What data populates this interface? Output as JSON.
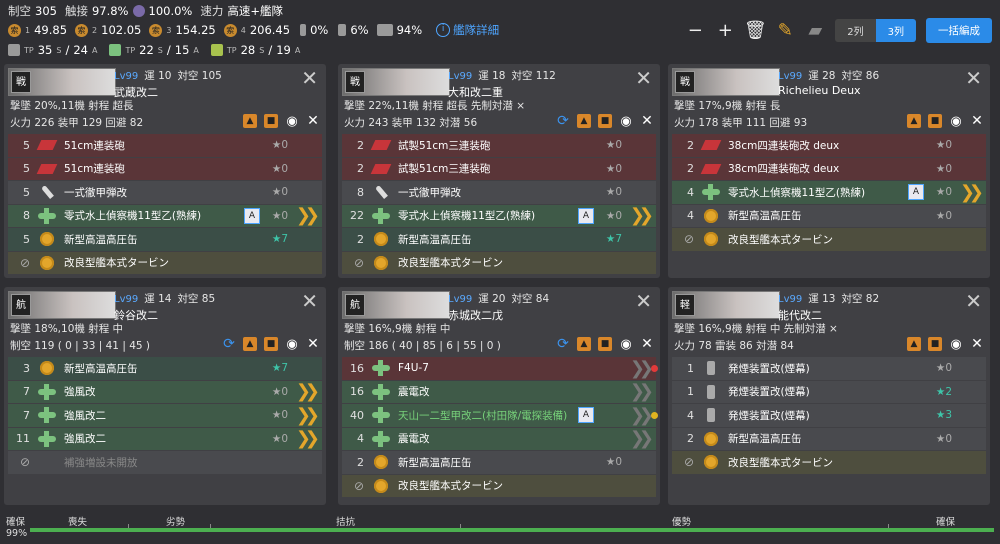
{
  "header": {
    "air_label": "制空",
    "air": "305",
    "contact_label": "触接",
    "contact": "97.8%",
    "sight_pct": "100.0%",
    "speed_label": "速力",
    "speed": "高速+艦隊",
    "los": [
      {
        "n": "1",
        "v": "49.85"
      },
      {
        "n": "2",
        "v": "102.05"
      },
      {
        "n": "3",
        "v": "154.25"
      },
      {
        "n": "4",
        "v": "206.45"
      }
    ],
    "drum_pct": "0%",
    "ration_pct": "6%",
    "combat_pct": "94%",
    "detail_label": "艦隊詳細",
    "tp": [
      {
        "v": "35",
        "s": "S",
        "t": "24",
        "a": "A"
      },
      {
        "v": "22",
        "s": "S",
        "t": "15",
        "a": "A"
      },
      {
        "v": "28",
        "s": "S",
        "t": "19",
        "a": "A"
      }
    ],
    "col2_label": "2列",
    "col3_label": "3列",
    "bulk_label": "一括編成"
  },
  "ships": [
    {
      "badge": "戦",
      "lv": "Lv99",
      "luck_label": "運",
      "luck": "10",
      "aa_label": "対空",
      "aa": "105",
      "name": "武蔵改二",
      "line2": "撃墜 20%,11機  射程 超長",
      "line3": "火力 226  装甲 129  回避 82",
      "equips": [
        {
          "slot": "5",
          "name": "51cm連装砲",
          "star": "★0",
          "cls": "red",
          "icon": "gun"
        },
        {
          "slot": "5",
          "name": "51cm連装砲",
          "star": "★0",
          "cls": "red",
          "icon": "gun"
        },
        {
          "slot": "5",
          "name": "一式徹甲弾改",
          "star": "★0",
          "cls": "gray",
          "icon": "shell"
        },
        {
          "slot": "8",
          "name": "零式水上偵察機11型乙(熟練)",
          "star": "★0",
          "cls": "green",
          "icon": "plane",
          "a": "A",
          "chev": "y"
        },
        {
          "slot": "5",
          "name": "新型高温高圧缶",
          "star": "★7",
          "cls": "tgreen",
          "icon": "boiler",
          "g": true
        },
        {
          "slot": "",
          "name": "改良型艦本式タービン",
          "star": "",
          "cls": "olive",
          "icon": "boiler",
          "ban": true
        }
      ]
    },
    {
      "badge": "戦",
      "lv": "Lv99",
      "luck_label": "運",
      "luck": "18",
      "aa_label": "対空",
      "aa": "112",
      "name": "大和改二重",
      "line2": "撃墜 22%,11機  射程 超長  先制対潜 ×",
      "line3": "火力 243  装甲 132  対潜 56",
      "equips": [
        {
          "slot": "2",
          "name": "試製51cm三連装砲",
          "star": "★0",
          "cls": "red",
          "icon": "gun"
        },
        {
          "slot": "2",
          "name": "試製51cm三連装砲",
          "star": "★0",
          "cls": "red",
          "icon": "gun"
        },
        {
          "slot": "8",
          "name": "一式徹甲弾改",
          "star": "★0",
          "cls": "gray",
          "icon": "shell"
        },
        {
          "slot": "22",
          "name": "零式水上偵察機11型乙(熟練)",
          "star": "★0",
          "cls": "green",
          "icon": "plane",
          "a": "A",
          "chev": "y"
        },
        {
          "slot": "2",
          "name": "新型高温高圧缶",
          "star": "★7",
          "cls": "tgreen",
          "icon": "boiler",
          "g": true
        },
        {
          "slot": "",
          "name": "改良型艦本式タービン",
          "star": "",
          "cls": "olive",
          "icon": "boiler",
          "ban": true
        }
      ]
    },
    {
      "badge": "戦",
      "lv": "Lv99",
      "luck_label": "運",
      "luck": "28",
      "aa_label": "対空",
      "aa": "86",
      "name": "Richelieu Deux",
      "line2": "撃墜 17%,9機  射程 長",
      "line3": "火力 178  装甲 111  回避 93",
      "equips": [
        {
          "slot": "2",
          "name": "38cm四連装砲改 deux",
          "star": "★0",
          "cls": "red",
          "icon": "gun"
        },
        {
          "slot": "2",
          "name": "38cm四連装砲改 deux",
          "star": "★0",
          "cls": "red",
          "icon": "gun"
        },
        {
          "slot": "4",
          "name": "零式水上偵察機11型乙(熟練)",
          "star": "★0",
          "cls": "green",
          "icon": "plane",
          "a": "A",
          "chev": "y"
        },
        {
          "slot": "4",
          "name": "新型高温高圧缶",
          "star": "★0",
          "cls": "gray",
          "icon": "boiler"
        },
        {
          "slot": "",
          "name": "改良型艦本式タービン",
          "star": "",
          "cls": "olive",
          "icon": "boiler",
          "ban": true
        }
      ]
    },
    {
      "badge": "航",
      "lv": "Lv99",
      "luck_label": "運",
      "luck": "14",
      "aa_label": "対空",
      "aa": "85",
      "name": "鈴谷改二",
      "line2": "撃墜 18%,10機  射程 中",
      "line3": "制空 119 ( 0 | 33 | 41 | 45 )",
      "equips": [
        {
          "slot": "3",
          "name": "新型高温高圧缶",
          "star": "★7",
          "cls": "tgreen",
          "icon": "boiler",
          "g": true
        },
        {
          "slot": "7",
          "name": "強風改",
          "star": "★0",
          "cls": "green",
          "icon": "plane",
          "chev": "y"
        },
        {
          "slot": "7",
          "name": "強風改二",
          "star": "★0",
          "cls": "green",
          "icon": "plane",
          "chev": "y"
        },
        {
          "slot": "11",
          "name": "強風改二",
          "star": "★0",
          "cls": "green",
          "icon": "plane",
          "chev": "y"
        },
        {
          "slot": "",
          "name": "補強増設未開放",
          "star": "",
          "cls": "gray",
          "icon": "none",
          "ban": true,
          "dim": true
        }
      ]
    },
    {
      "badge": "航",
      "lv": "Lv99",
      "luck_label": "運",
      "luck": "20",
      "aa_label": "対空",
      "aa": "84",
      "name": "赤城改二戊",
      "line2": "撃墜 16%,9機  射程 中",
      "line3": "制空 186 ( 40 | 85 | 6 | 55 | 0 )",
      "equips": [
        {
          "slot": "16",
          "name": "F4U-7",
          "star": "",
          "cls": "red",
          "icon": "plane",
          "chev": "g",
          "dot": "r"
        },
        {
          "slot": "16",
          "name": "震電改",
          "star": "",
          "cls": "green",
          "icon": "plane",
          "chev": "g"
        },
        {
          "slot": "40",
          "name": "天山一二型甲改二(村田隊/電探装備)",
          "star": "",
          "cls": "green",
          "icon": "plane",
          "a": "A",
          "chev": "g",
          "dot": "y",
          "grn": true
        },
        {
          "slot": "4",
          "name": "震電改",
          "star": "",
          "cls": "green",
          "icon": "plane",
          "chev": "g"
        },
        {
          "slot": "2",
          "name": "新型高温高圧缶",
          "star": "★0",
          "cls": "gray",
          "icon": "boiler"
        },
        {
          "slot": "",
          "name": "改良型艦本式タービン",
          "star": "",
          "cls": "olive",
          "icon": "boiler",
          "ban": true
        }
      ]
    },
    {
      "badge": "軽",
      "lv": "Lv99",
      "luck_label": "運",
      "luck": "13",
      "aa_label": "対空",
      "aa": "82",
      "name": "能代改二",
      "line2": "撃墜 16%,9機  射程 中  先制対潜 ×",
      "line3": "火力 78  雷装 86  対潜 84",
      "equips": [
        {
          "slot": "1",
          "name": "発煙装置改(煙幕)",
          "star": "★0",
          "cls": "gray",
          "icon": "smoke"
        },
        {
          "slot": "1",
          "name": "発煙装置改(煙幕)",
          "star": "★2",
          "cls": "gray",
          "icon": "smoke",
          "g": true
        },
        {
          "slot": "4",
          "name": "発煙装置改(煙幕)",
          "star": "★3",
          "cls": "gray",
          "icon": "smoke",
          "g": true
        },
        {
          "slot": "2",
          "name": "新型高温高圧缶",
          "star": "★0",
          "cls": "gray",
          "icon": "boiler"
        },
        {
          "slot": "",
          "name": "改良型艦本式タービン",
          "star": "",
          "cls": "olive",
          "icon": "boiler",
          "ban": true
        }
      ]
    }
  ],
  "bottom": {
    "secure": "確保",
    "pct": "99%",
    "labels": [
      "喪失",
      "劣勢",
      "拮抗",
      "優勢",
      "確保"
    ]
  }
}
